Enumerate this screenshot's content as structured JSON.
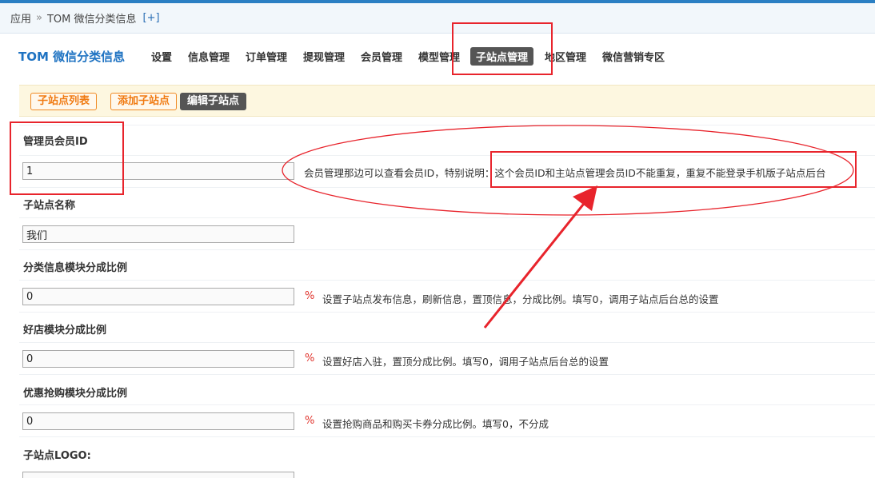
{
  "breadcrumb": {
    "root": "应用",
    "separator": "»",
    "current": "TOM 微信分类信息",
    "add_label": "[+]"
  },
  "nav": {
    "brand": "TOM 微信分类信息",
    "items": [
      "设置",
      "信息管理",
      "订单管理",
      "提现管理",
      "会员管理",
      "模型管理",
      "子站点管理",
      "地区管理",
      "微信营销专区"
    ],
    "active_index": 6
  },
  "subtabs": [
    "子站点列表",
    "添加子站点",
    "编辑子站点"
  ],
  "form": {
    "admin_id": {
      "label": "管理员会员ID",
      "value": "1",
      "hint": "会员管理那边可以查看会员ID，特别说明：这个会员ID和主站点管理会员ID不能重复，重复不能登录手机版子站点后台"
    },
    "site_name": {
      "label": "子站点名称",
      "value": "我们"
    },
    "classify_ratio": {
      "label": "分类信息模块分成比例",
      "value": "0",
      "unit": "%",
      "hint": "设置子站点发布信息，刷新信息，置顶信息，分成比例。填写0，调用子站点后台总的设置"
    },
    "shop_ratio": {
      "label": "好店模块分成比例",
      "value": "0",
      "unit": "%",
      "hint": "设置好店入驻，置顶分成比例。填写0，调用子站点后台总的设置"
    },
    "coupon_ratio": {
      "label": "优惠抢购模块分成比例",
      "value": "0",
      "unit": "%",
      "hint": "设置抢购商品和购买卡券分成比例。填写0，不分成"
    },
    "logo": {
      "label": "子站点LOGO:"
    }
  },
  "colors": {
    "accent": "#1f73c2",
    "active_tab": "#555555",
    "subtab_outline": "#f08a24",
    "annotation": "#e8242c",
    "unit": "#e0332c"
  }
}
